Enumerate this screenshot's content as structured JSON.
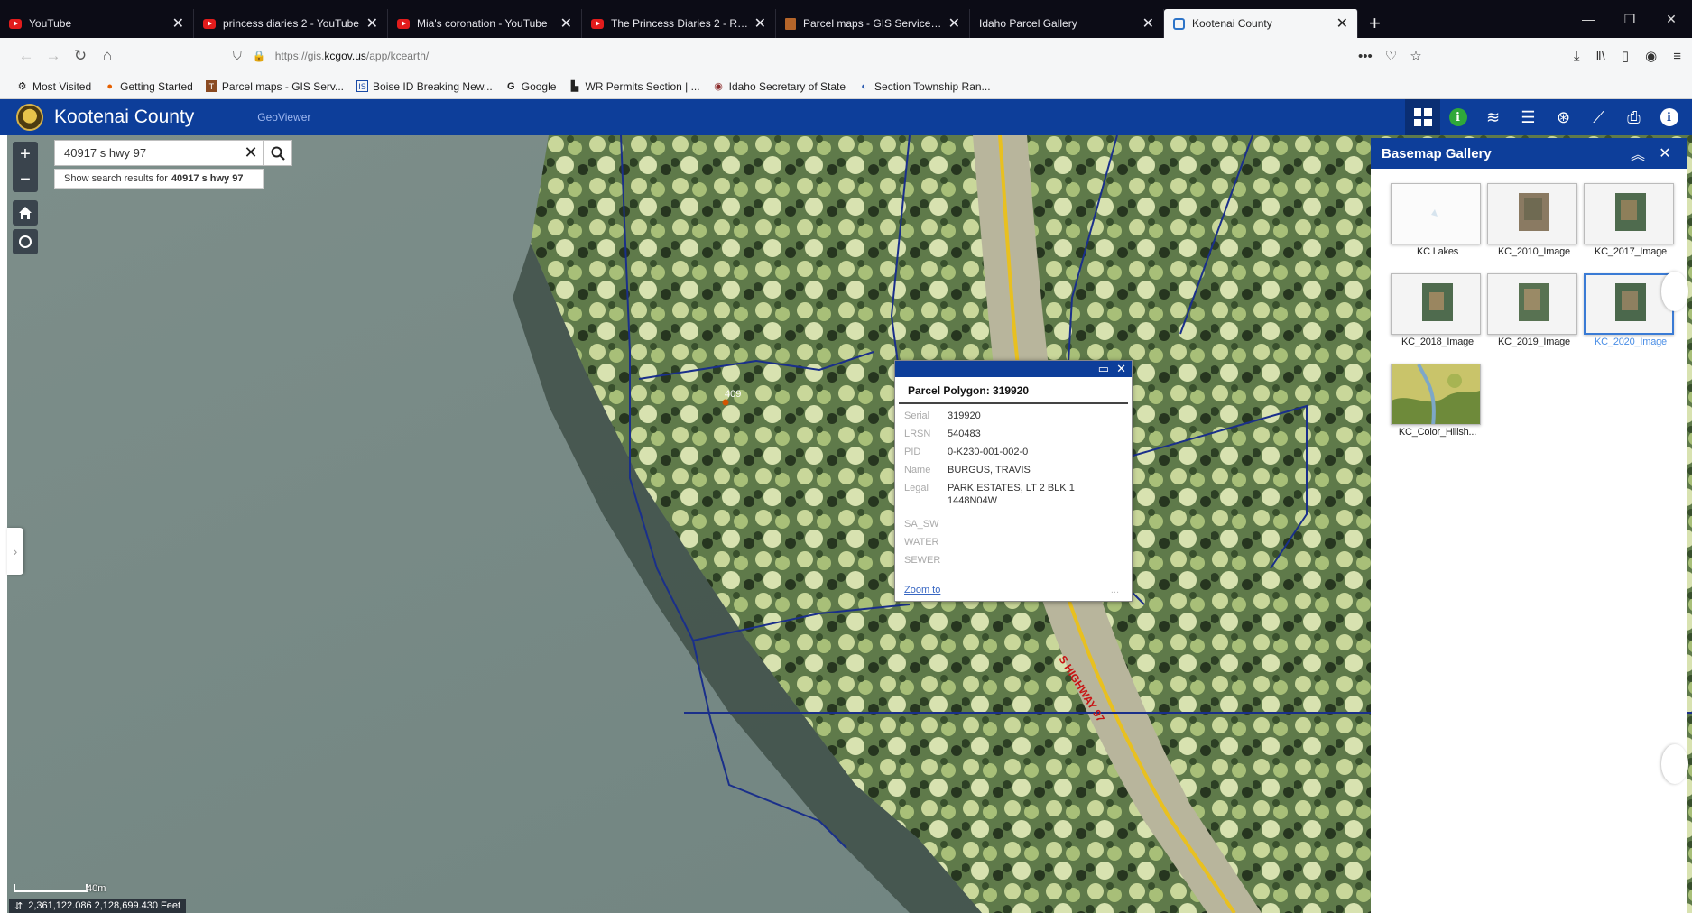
{
  "browser": {
    "tabs": [
      {
        "title": "YouTube",
        "icon": "youtube-icon",
        "active": false
      },
      {
        "title": "princess diaries 2 - YouTube",
        "icon": "youtube-icon",
        "active": false
      },
      {
        "title": "Mia's coronation - YouTube",
        "icon": "youtube-icon",
        "active": false
      },
      {
        "title": "The Princess Diaries 2 - Royal ...",
        "icon": "youtube-icon",
        "active": false
      },
      {
        "title": "Parcel maps - GIS Services - ...",
        "icon": "gis-icon",
        "active": false
      },
      {
        "title": "Idaho Parcel Gallery",
        "icon": "none",
        "active": false
      },
      {
        "title": "Kootenai County",
        "icon": "kootenai-icon",
        "active": true
      }
    ],
    "url_prefix": "https://gis.",
    "url_host": "kcgov.us",
    "url_path": "/app/kcearth/",
    "bookmarks": [
      {
        "label": "Most Visited",
        "icon": "gear-icon"
      },
      {
        "label": "Getting Started",
        "icon": "firefox-icon"
      },
      {
        "label": "Parcel maps - GIS Serv...",
        "icon": "gis-icon"
      },
      {
        "label": "Boise ID Breaking New...",
        "icon": "news-icon"
      },
      {
        "label": "Google",
        "icon": "google-icon"
      },
      {
        "label": "WR Permits Section | ...",
        "icon": "idaho-icon"
      },
      {
        "label": "Idaho Secretary of State",
        "icon": "seal-icon"
      },
      {
        "label": "Section Township Ran...",
        "icon": "globe-icon"
      }
    ]
  },
  "app": {
    "title": "Kootenai County",
    "subtitle": "GeoViewer"
  },
  "search": {
    "value": "40917 s hwy 97",
    "suggest_prefix": "Show search results for",
    "suggest_query": "40917 s hwy 97"
  },
  "map": {
    "scale_label": "40m",
    "coordinates": "2,361,122.086 2,128,699.430 Feet",
    "road_label": "S HIGHWAY 97",
    "address_marker": "409"
  },
  "popup": {
    "title": "Parcel Polygon: 319920",
    "fields": [
      {
        "key": "Serial",
        "value": "319920"
      },
      {
        "key": "LRSN",
        "value": "540483"
      },
      {
        "key": "PID",
        "value": "0-K230-001-002-0"
      },
      {
        "key": "Name",
        "value": "BURGUS, TRAVIS"
      },
      {
        "key": "Legal",
        "value": "PARK ESTATES, LT 2 BLK 1 1448N04W"
      },
      {
        "key": "SA_SW",
        "value": ""
      },
      {
        "key": "WATER",
        "value": ""
      },
      {
        "key": "SEWER",
        "value": ""
      }
    ],
    "zoom_link": "Zoom to",
    "more": "..."
  },
  "gallery": {
    "title": "Basemap Gallery",
    "items": [
      {
        "label": "KC Lakes",
        "kind": "lakes",
        "selected": false
      },
      {
        "label": "KC_2010_Image",
        "kind": "image-a",
        "selected": false
      },
      {
        "label": "KC_2017_Image",
        "kind": "image-b",
        "selected": false
      },
      {
        "label": "KC_2018_Image",
        "kind": "image-b",
        "selected": false
      },
      {
        "label": "KC_2019_Image",
        "kind": "image-b",
        "selected": false
      },
      {
        "label": "KC_2020_Image",
        "kind": "image-b",
        "selected": true
      },
      {
        "label": "KC_Color_Hillsh...",
        "kind": "hillshade",
        "selected": false
      }
    ]
  },
  "colors": {
    "header_blue": "#0d3e9a",
    "water": "#7a8c89",
    "parcel_line": "#1a2f8a",
    "road_yellow": "#e8c020"
  }
}
